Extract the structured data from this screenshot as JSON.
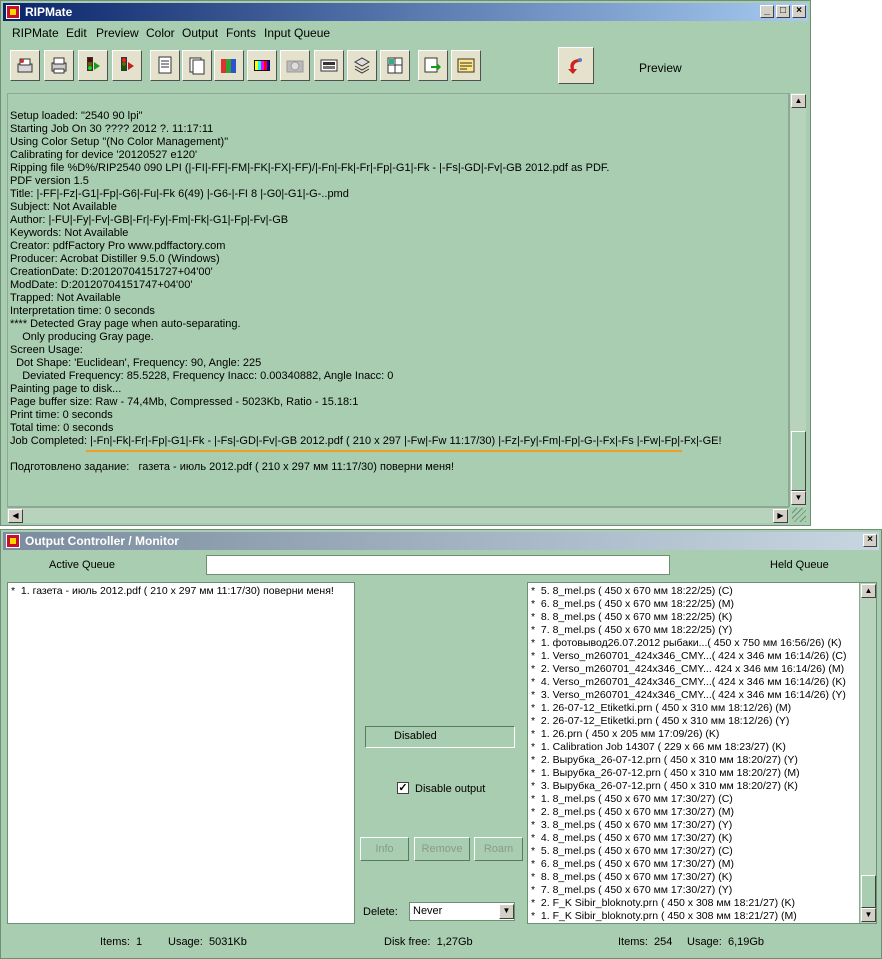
{
  "ripmate": {
    "title": "RIPMate",
    "menu": [
      "RIPMate",
      "Edit",
      "Preview",
      "Color",
      "Output",
      "Fonts",
      "Input Queue"
    ],
    "toolbar_icons": [
      "open-job-icon",
      "printer-icon",
      "traffic-light-green-icon",
      "traffic-light-red-icon",
      "page-setup-icon",
      "document-icon",
      "color-palette-icon",
      "color-bars-icon",
      "camera-icon",
      "font-icon",
      "layers-icon",
      "tile-icon",
      "queue-arrow-icon",
      "queue-list-icon"
    ],
    "preview_label": "Preview",
    "log": [
      "Setup loaded: \"2540 90 lpi\"",
      "Starting Job On 30 ???? 2012 ?. 11:17:11",
      "Using Color Setup \"(No Color Management)\"",
      "Calibrating for device '20120527 e120'",
      "Ripping file %D%/RIP2540 090 LPI (|-FI|-FF|-FM|-FK|-FX|-FF)/|-Fn|-Fk|-Fr|-Fp|-G1|-Fk - |-Fs|-GD|-Fv|-GB 2012.pdf as PDF.",
      "PDF version 1.5",
      "Title: |-FF|-Fz|-G1|-Fp|-G6|-Fu|-Fk 6(49) |-G6-|-FI 8 |-G0|-G1|-G-..pmd",
      "Subject: Not Available",
      "Author: |-FU|-Fy|-Fv|-GB|-Fr|-Fy|-Fm|-Fk|-G1|-Fp|-Fv|-GB",
      "Keywords: Not Available",
      "Creator: pdfFactory Pro www.pdffactory.com",
      "Producer: Acrobat Distiller 9.5.0 (Windows)",
      "CreationDate: D:20120704151727+04'00'",
      "ModDate: D:20120704151747+04'00'",
      "Trapped: Not Available",
      "Interpretation time: 0 seconds",
      "**** Detected Gray page when auto-separating.",
      "    Only producing Gray page.",
      "Screen Usage:",
      "  Dot Shape: 'Euclidean', Frequency: 90, Angle: 225",
      "    Deviated Frequency: 85.5228, Frequency Inacc: 0.00340882, Angle Inacc: 0",
      "Painting page to disk...",
      "Page buffer size: Raw - 74,4Mb, Compressed - 5023Kb, Ratio - 15.18:1",
      "Print time: 0 seconds",
      "Total time: 0 seconds",
      "Job Completed: |-Fn|-Fk|-Fr|-Fp|-G1|-Fk - |-Fs|-GD|-Fv|-GB 2012.pdf ( 210 x 297 |-Fw|-Fw 11:17/30) |-Fz|-Fy|-Fm|-Fp|-G-|-Fx|-Fs |-Fw|-Fp|-Fx|-GE!",
      "",
      "Подготовлено задание:   газета - июль 2012.pdf ( 210 x 297 мм 11:17/30) поверни меня!"
    ]
  },
  "monitor": {
    "title": "Output Controller / Monitor",
    "active_queue_label": "Active Queue",
    "held_queue_label": "Held Queue",
    "active_items": [
      "*  1. газета - июль 2012.pdf ( 210 x 297 мм 11:17/30) поверни меня!"
    ],
    "held_items": [
      "*  5. 8_mel.ps ( 450 x 670 мм 18:22/25) (C)",
      "*  6. 8_mel.ps ( 450 x 670 мм 18:22/25) (M)",
      "*  8. 8_mel.ps ( 450 x 670 мм 18:22/25) (K)",
      "*  7. 8_mel.ps ( 450 x 670 мм 18:22/25) (Y)",
      "*  1. фотовывод26.07.2012 рыбаки...( 450 x 750 мм 16:56/26) (K)",
      "*  1. Verso_m260701_424x346_CMY...( 424 x 346 мм 16:14/26) (C)",
      "*  2. Verso_m260701_424x346_CMY... 424 x 346 мм 16:14/26) (M)",
      "*  4. Verso_m260701_424x346_CMY...( 424 x 346 мм 16:14/26) (K)",
      "*  3. Verso_m260701_424x346_CMY...( 424 x 346 мм 16:14/26) (Y)",
      "*  1. 26-07-12_Etiketki.prn ( 450 x 310 мм 18:12/26) (M)",
      "*  2. 26-07-12_Etiketki.prn ( 450 x 310 мм 18:12/26) (Y)",
      "*  1. 26.prn ( 450 x 205 мм 17:09/26) (K)",
      "*  1. Calibration Job 14307 ( 229 x 66 мм 18:23/27) (K)",
      "*  2. Вырубка_26-07-12.prn ( 450 x 310 мм 18:20/27) (Y)",
      "*  1. Вырубка_26-07-12.prn ( 450 x 310 мм 18:20/27) (M)",
      "*  3. Вырубка_26-07-12.prn ( 450 x 310 мм 18:20/27) (K)",
      "*  1. 8_mel.ps ( 450 x 670 мм 17:30/27) (C)",
      "*  2. 8_mel.ps ( 450 x 670 мм 17:30/27) (M)",
      "*  3. 8_mel.ps ( 450 x 670 мм 17:30/27) (Y)",
      "*  4. 8_mel.ps ( 450 x 670 мм 17:30/27) (K)",
      "*  5. 8_mel.ps ( 450 x 670 мм 17:30/27) (C)",
      "*  6. 8_mel.ps ( 450 x 670 мм 17:30/27) (M)",
      "*  8. 8_mel.ps ( 450 x 670 мм 17:30/27) (K)",
      "*  7. 8_mel.ps ( 450 x 670 мм 17:30/27) (Y)",
      "*  2. F_K Sibir_bloknoty.prn ( 450 x 308 мм 18:21/27) (K)",
      "*  1. F_K Sibir_bloknoty.prn ( 450 x 308 мм 18:21/27) (M)"
    ],
    "status_text": "Disabled",
    "disable_output_label": "Disable output",
    "disable_output_checked": true,
    "buttons": {
      "info": "Info",
      "remove": "Remove",
      "roam": "Roam"
    },
    "delete_label": "Delete:",
    "delete_value": "Never",
    "status_bar": {
      "active_items": "Items:  1",
      "active_usage": "Usage:  5031Kb",
      "disk_free": "Disk free:  1,27Gb",
      "held_items": "Items:  254",
      "held_usage": "Usage:  6,19Gb"
    }
  },
  "colors": {
    "panel_bg": "#a9cdb0",
    "highlight_underline": "#f0a020"
  }
}
